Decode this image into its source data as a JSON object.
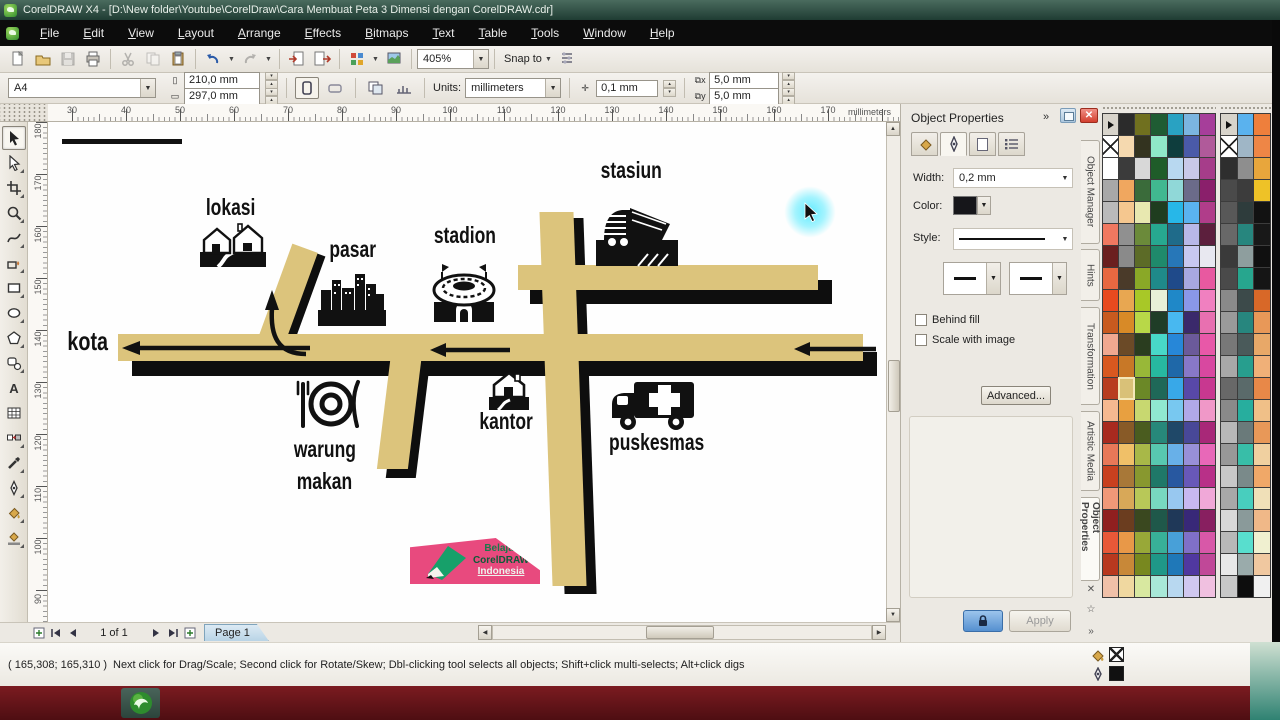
{
  "window": {
    "title": "CorelDRAW X4 - [D:\\New folder\\Youtube\\CorelDraw\\Cara Membuat Peta 3 Dimensi dengan CorelDRAW.cdr]"
  },
  "menu": [
    "File",
    "Edit",
    "View",
    "Layout",
    "Arrange",
    "Effects",
    "Bitmaps",
    "Text",
    "Table",
    "Tools",
    "Window",
    "Help"
  ],
  "std_toolbar": {
    "zoom_value": "405%",
    "snap_label": "Snap to"
  },
  "prop_bar": {
    "preset": "A4",
    "paper_w": "210,0 mm",
    "paper_h": "297,0 mm",
    "units_label": "Units:",
    "units": "millimeters",
    "nudge": "0,1 mm",
    "dup_x": "5,0 mm",
    "dup_y": "5,0 mm"
  },
  "rulers": {
    "h_ticks": [
      "30",
      "40",
      "50",
      "60",
      "70",
      "80",
      "90",
      "100",
      "110",
      "120",
      "130",
      "140",
      "150",
      "160",
      "170"
    ],
    "h_unit": "millimeters",
    "v_ticks": [
      "180",
      "170",
      "160",
      "150",
      "140",
      "130",
      "120",
      "110",
      "100",
      "90"
    ]
  },
  "toolbox": [
    "pick",
    "shape",
    "crop",
    "zoom",
    "freehand",
    "smart-fill",
    "rectangle",
    "ellipse",
    "polygon",
    "basic-shapes",
    "text",
    "table",
    "interactive-blend",
    "eyedropper",
    "outline-pen",
    "fill",
    "interactive-fill"
  ],
  "map": {
    "labels": {
      "kota": "kota",
      "lokasi": "lokasi",
      "pasar": "pasar",
      "stadion": "stadion",
      "stasiun": "stasiun",
      "warung": "warung",
      "makan": "makan",
      "kantor": "kantor",
      "puskesmas": "puskesmas"
    },
    "logo": {
      "line1": "Belajar",
      "line2": "CorelDRAW",
      "line3": "Indonesia"
    },
    "road_color": "#dcc47c",
    "logo_color": "#e84a7e"
  },
  "docker": {
    "title": "Object Properties",
    "width_label": "Width:",
    "width_value": "0,2 mm",
    "color_label": "Color:",
    "style_label": "Style:",
    "behind_fill_label": "Behind fill",
    "scale_with_image_label": "Scale with image",
    "advanced_label": "Advanced...",
    "apply_label": "Apply",
    "side_tabs": [
      "Object Manager",
      "Hints",
      "Transformation",
      "Artistic Media",
      "Object Properties"
    ]
  },
  "page_bar": {
    "counter": "1 of 1",
    "tab": "Page 1"
  },
  "status_bar": {
    "coords": "( 165,308; 165,310 )",
    "hint": "Next click for Drag/Scale; Second click for Rotate/Skew; Dbl-clicking tool selects all objects; Shift+click multi-selects; Alt+click digs"
  },
  "palettes": {
    "a": {
      "cols": 7,
      "selected_index": 85,
      "cells": [
        "ARROW",
        "#2b2b2b",
        "#70701f",
        "#1f5c33",
        "#29a2c2",
        "#7bb5e0",
        "#a63e9a",
        "X",
        "#f5d9af",
        "#33331f",
        "#8fe8c8",
        "#0e3d3d",
        "#4a5aa8",
        "#b05a9a",
        "#ffffff",
        "#3b3b3b",
        "#d8d8d8",
        "#1f5c29",
        "#b8d8f0",
        "#c9c9e8",
        "#a63d8a",
        "#a8a8a8",
        "#f0a75f",
        "#3a6b3a",
        "#41b890",
        "#90d8d8",
        "#6b6b8a",
        "#8a1f6b",
        "#bababa",
        "#f5c78f",
        "#e8e8b0",
        "#1f3d1f",
        "#27b7e8",
        "#5ab3f0",
        "#b03d8a",
        "#f07860",
        "#909090",
        "#6b8a3a",
        "#27a890",
        "#1f6b8a",
        "#b8b8e8",
        "#5c1f3d",
        "#6b1f1f",
        "#8a8a8a",
        "#5c6b27",
        "#1f8a6b",
        "#2777b8",
        "#c8c8f0",
        "#e8e8f0",
        "#e86841",
        "#4a3a29",
        "#8aa827",
        "#1f8a8a",
        "#1f4a8a",
        "#a8a8e0",
        "#e859a0",
        "#e84a1f",
        "#e8a751",
        "#a8c827",
        "#e8f0d8",
        "#1f88c8",
        "#8a97e8",
        "#f080c0",
        "#c85a1f",
        "#d88a27",
        "#b8d848",
        "#1f3d27",
        "#48b8f0",
        "#3a296b",
        "#e870b0",
        "#f0a890",
        "#6b4a27",
        "#2a3d1f",
        "#48d8c8",
        "#2787d8",
        "#6b5a9a",
        "#e858a8",
        "#d8581f",
        "#c87827",
        "#98b838",
        "#27b8a0",
        "#1f68a8",
        "#8878c8",
        "#d848a0",
        "#b83d1f",
        "#d9c178",
        "#6b8827",
        "#1f6858",
        "#38a8e8",
        "#5848a8",
        "#c83890",
        "#f5b890",
        "#e8a040",
        "#c8d870",
        "#90e8d0",
        "#78c8f0",
        "#b0a8e8",
        "#f098c8",
        "#a82a1f",
        "#885a27",
        "#4a5c1f",
        "#27887a",
        "#1f4868",
        "#484898",
        "#a82878",
        "#e87858",
        "#f0c068",
        "#a8b848",
        "#58c8b0",
        "#68b0e8",
        "#9890d8",
        "#e868b8",
        "#c8401f",
        "#a87838",
        "#88982f",
        "#1f7868",
        "#2858a0",
        "#6858b8",
        "#b83088",
        "#f09878",
        "#d8a858",
        "#b8c858",
        "#78d8c0",
        "#98c8f0",
        "#c8b8f0",
        "#f0a8d8",
        "#901f1f",
        "#6b3d1f",
        "#3a481f",
        "#1f584a",
        "#1f3858",
        "#382878",
        "#881f60",
        "#e85838",
        "#e89848",
        "#98a838",
        "#38b098",
        "#48a0d8",
        "#8070c8",
        "#d858a8",
        "#b8381f",
        "#c88838",
        "#78881f",
        "#1f9888",
        "#1f78b8",
        "#5038a0",
        "#c04898",
        "#f0c0a8",
        "#f0d8a0",
        "#d8e8a0",
        "#a8e8d8",
        "#b8d8f0",
        "#d0c8f0",
        "#f0c0e0"
      ]
    },
    "b": {
      "cols": 3,
      "cells": [
        "ARROW",
        "#5ab2ee",
        "#ee7f3c",
        "X",
        "#9fb6c6",
        "#ee8646",
        "#2e2e2e",
        "#8e8e8e",
        "#e8a63c",
        "#4a4a4a",
        "#3c3c3c",
        "#eec227",
        "#585858",
        "#2e3c3c",
        "#121212",
        "#686868",
        "#27867e",
        "#181818",
        "#3a3a3a",
        "#8e9e9e",
        "#101010",
        "#4a4a4a",
        "#27a68e",
        "#151515",
        "#8a8a8a",
        "#3c4a4a",
        "#d86828",
        "#9a9a9a",
        "#27867e",
        "#e89858",
        "#787878",
        "#4a5a5a",
        "#e8a868",
        "#a8a8a8",
        "#279e8e",
        "#f0b078",
        "#686868",
        "#5a6a6a",
        "#e88848",
        "#8a8a8a",
        "#27ae9e",
        "#f0c088",
        "#b8b8b8",
        "#6a7a7a",
        "#e89858",
        "#989898",
        "#38bea8",
        "#f0d0a0",
        "#c8c8c8",
        "#7a8a8a",
        "#f0a868",
        "#a8a8a8",
        "#48cebe",
        "#f0e0b8",
        "#d8d8d8",
        "#8a9a9a",
        "#f0b888",
        "#b8b8b8",
        "#58dece",
        "#f0f0d0",
        "#e8e8e8",
        "#9aabab",
        "#f0c8a0",
        "#c8c8c8",
        "#0d0d0d",
        "#f0f0f0"
      ]
    }
  }
}
